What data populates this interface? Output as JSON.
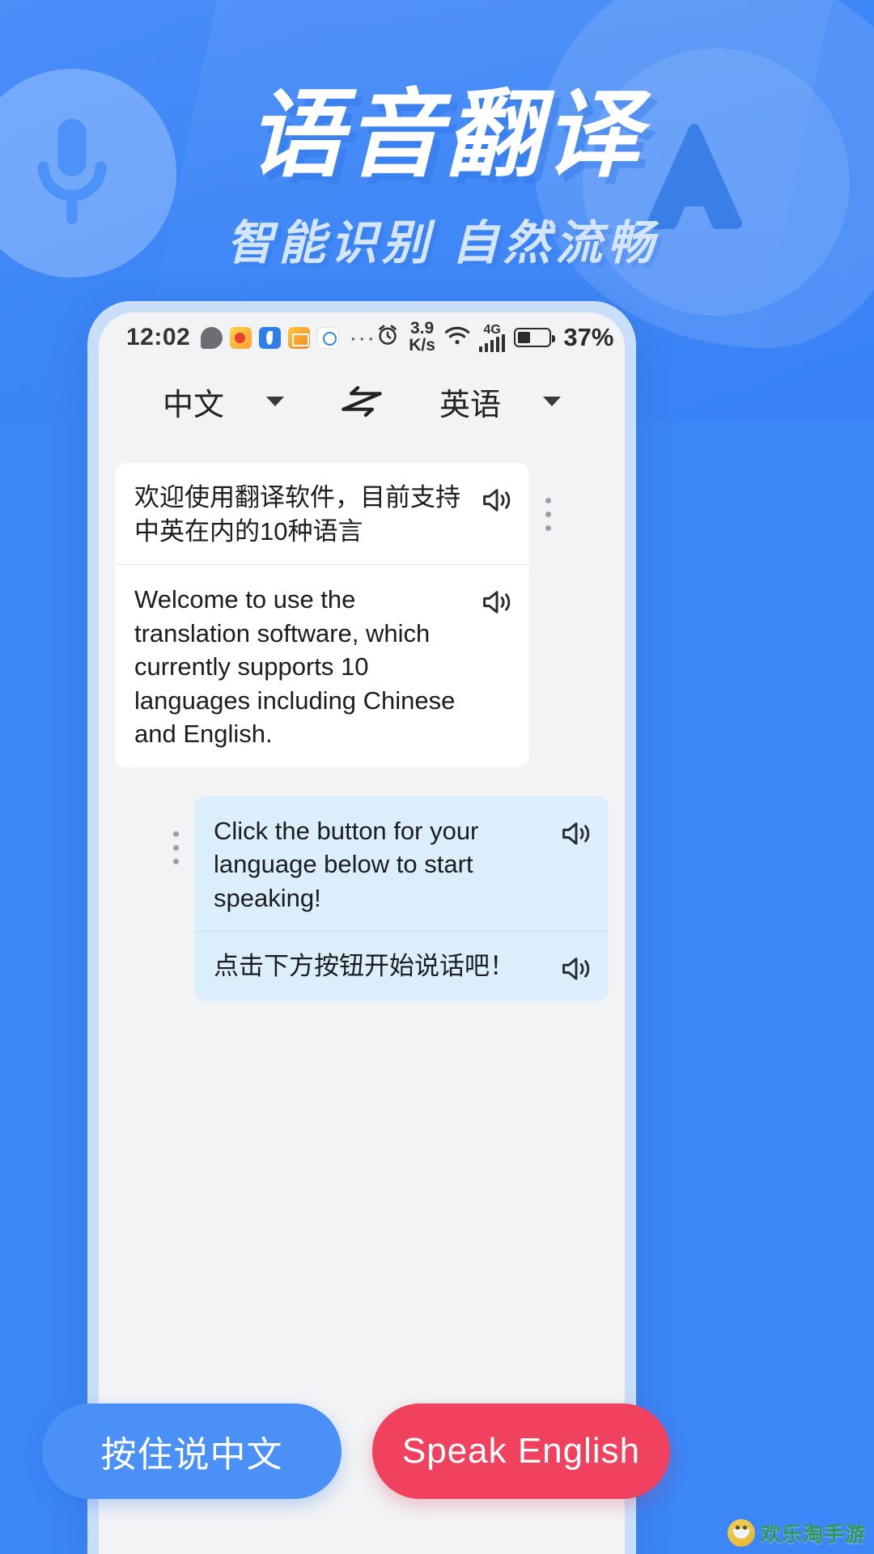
{
  "hero": {
    "title": "语音翻译",
    "subtitle": "智能识别  自然流畅",
    "mic_icon": "microphone-icon",
    "app_icon": "translate-a-icon",
    "bg_color": "#3d86f7",
    "title_color": "#ffffff",
    "subtitle_color": "#d4e6ff"
  },
  "phone": {
    "status_bar": {
      "time": "12:02",
      "app_icons": [
        "chat-icon",
        "weibo-icon",
        "blue-app-icon",
        "mail-icon",
        "search-bubble-icon"
      ],
      "overflow": "···",
      "alarm_icon": "alarm-clock-icon",
      "net_speed": "3.9",
      "net_speed_unit": "K/s",
      "wifi_icon": "wifi-icon",
      "network_type": "4G",
      "signal_icon": "signal-bars-icon",
      "battery_icon": "battery-icon",
      "battery_percent": "37%"
    },
    "language_bar": {
      "source_language": "中文",
      "target_language": "英语",
      "source_caret": "chevron-down-icon",
      "target_caret": "chevron-down-icon",
      "swap_icon": "swap-arrows-icon"
    },
    "conversation": [
      {
        "side": "left",
        "style": "white",
        "menu_icon": "kebab-menu-icon",
        "segments": [
          {
            "text": "欢迎使用翻译软件，目前支持中英在内的10种语言",
            "speaker_icon": "speaker-icon"
          },
          {
            "text": "Welcome to use the translation software, which currently supports 10 languages including Chinese and English.",
            "speaker_icon": "speaker-icon"
          }
        ]
      },
      {
        "side": "right",
        "style": "blue",
        "menu_icon": "kebab-menu-icon",
        "segments": [
          {
            "text": "Click the button for your language below to start speaking!",
            "speaker_icon": "speaker-icon"
          },
          {
            "text": "点击下方按钮开始说话吧！",
            "speaker_icon": "speaker-icon"
          }
        ]
      }
    ]
  },
  "bottom_buttons": {
    "chinese": {
      "label": "按住说中文",
      "color": "#4a90f7"
    },
    "english": {
      "label": "Speak English",
      "color": "#f0415f"
    }
  },
  "watermark": {
    "text": "欢乐淘手游",
    "logo_icon": "smiley-logo-icon",
    "color": "#2f9a4a"
  }
}
